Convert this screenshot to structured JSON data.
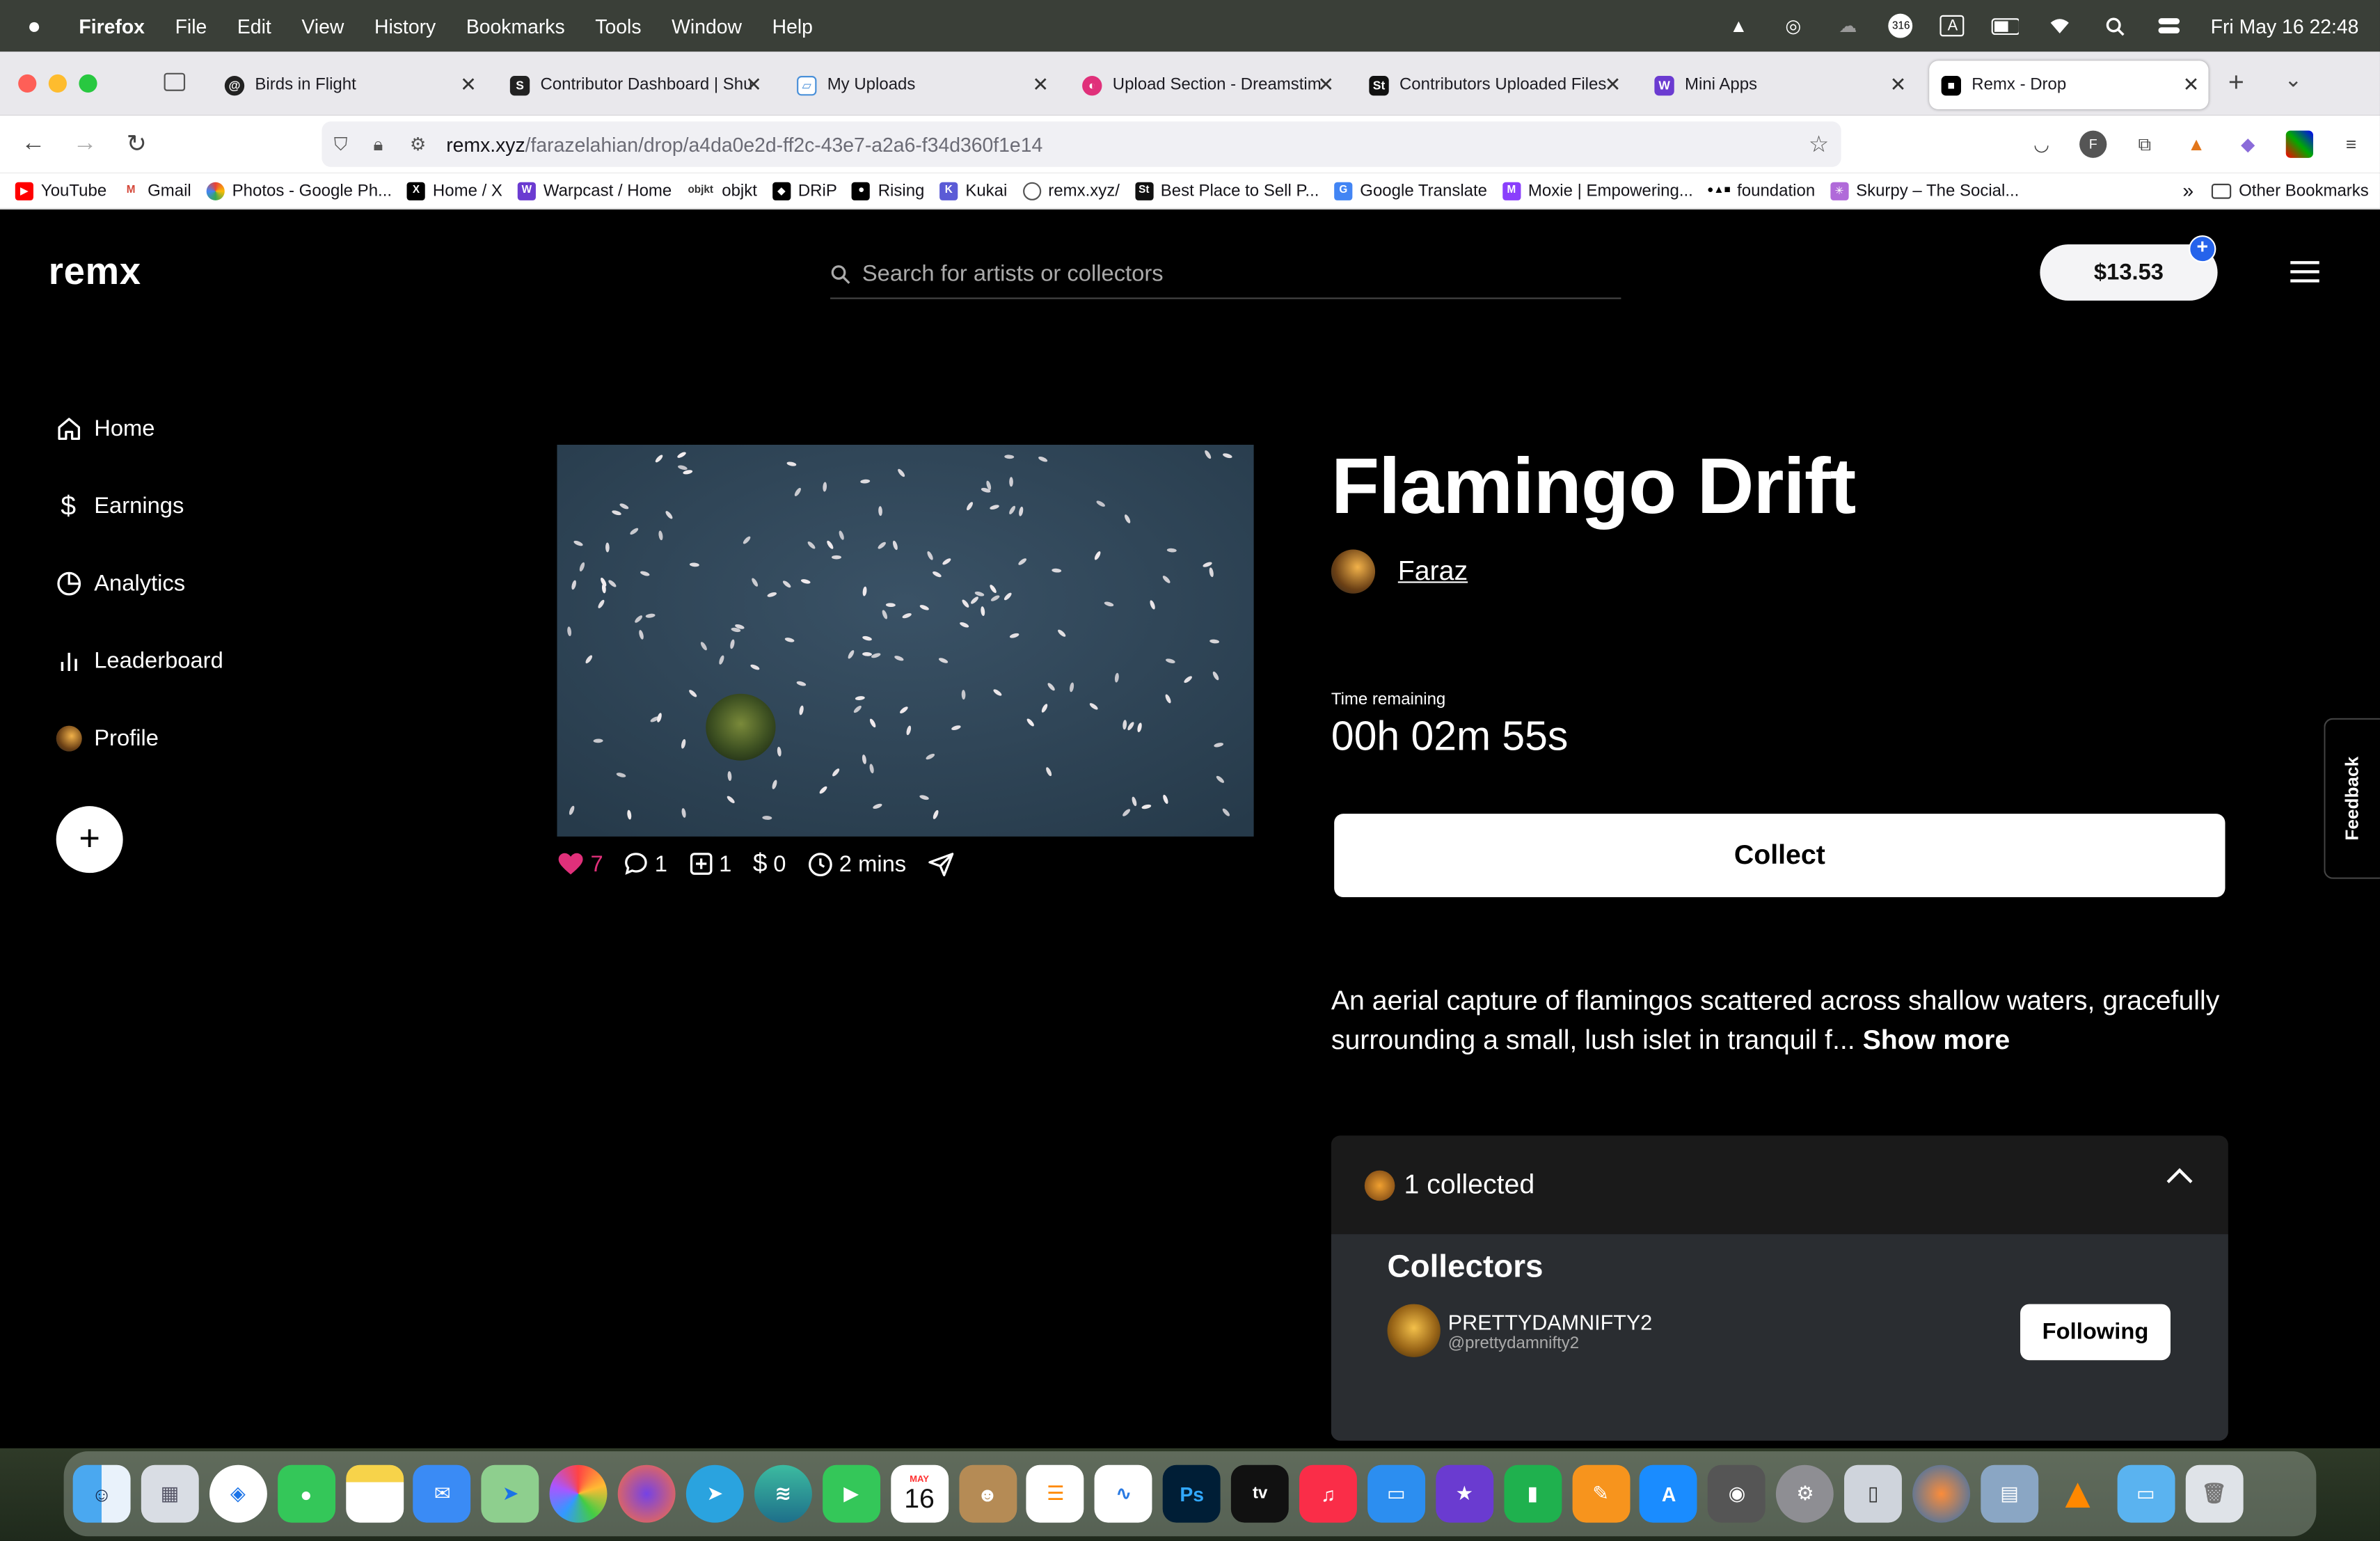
{
  "menubar": {
    "app": "Firefox",
    "items": [
      "File",
      "Edit",
      "View",
      "History",
      "Bookmarks",
      "Tools",
      "Window",
      "Help"
    ],
    "datetime": "Fri May 16  22:48",
    "badge_count": "316",
    "input_source": "A"
  },
  "tabs": [
    {
      "label": "Birds in Flight",
      "icon": "threads-icon",
      "color": "#222"
    },
    {
      "label": "Contributor Dashboard | Shu",
      "icon": "shutterstock-icon",
      "color": "#222"
    },
    {
      "label": "My Uploads",
      "icon": "uploads-icon",
      "color": "#4a90d9"
    },
    {
      "label": "Upload Section - Dreamstim",
      "icon": "dreamstime-icon",
      "color": "#e0307a"
    },
    {
      "label": "Contributors Uploaded Files",
      "icon": "stocksy-icon",
      "color": "#111"
    },
    {
      "label": "Mini Apps",
      "icon": "warpcast-icon",
      "color": "#6b3bd1"
    },
    {
      "label": "Remx - Drop",
      "icon": "remx-icon",
      "color": "#000"
    }
  ],
  "url": {
    "host": "remx.xyz",
    "path": "/farazelahian/drop/a4da0e2d-ff2c-43e7-a2a6-f34d360f1e14"
  },
  "bookmarks": [
    {
      "label": "YouTube",
      "color": "#ff0000"
    },
    {
      "label": "Gmail",
      "color": "#d44638"
    },
    {
      "label": "Photos - Google Ph...",
      "color": "#fbbc04"
    },
    {
      "label": "Home / X",
      "color": "#000"
    },
    {
      "label": "Warpcast / Home",
      "color": "#6b3bd1"
    },
    {
      "label": "objkt",
      "color": "#333"
    },
    {
      "label": "DRiP",
      "color": "#000"
    },
    {
      "label": "Rising",
      "color": "#000"
    },
    {
      "label": "Kukai",
      "color": "#5b5bd6"
    },
    {
      "label": "remx.xyz/",
      "color": "#555"
    },
    {
      "label": "Best Place to Sell P...",
      "color": "#111"
    },
    {
      "label": "Google Translate",
      "color": "#4285f4"
    },
    {
      "label": "Moxie | Empowering...",
      "color": "#8a3ffc"
    },
    {
      "label": "foundation",
      "color": "#000"
    },
    {
      "label": "Skurpy – The Social...",
      "color": "#b06ad9"
    }
  ],
  "other_bookmarks": "Other Bookmarks",
  "site": {
    "logo": "remx",
    "search_placeholder": "Search for artists or collectors",
    "balance": "$13.53",
    "nav": [
      {
        "label": "Home",
        "icon": "home-icon"
      },
      {
        "label": "Earnings",
        "icon": "dollar-icon"
      },
      {
        "label": "Analytics",
        "icon": "pie-chart-icon"
      },
      {
        "label": "Leaderboard",
        "icon": "bar-chart-icon"
      },
      {
        "label": "Profile",
        "icon": "avatar-icon"
      }
    ]
  },
  "drop": {
    "title": "Flamingo Drift",
    "artist": "Faraz",
    "stats": {
      "likes": "7",
      "comments": "1",
      "collects": "1",
      "earnings": "0",
      "age": "2 mins"
    },
    "time_remaining_label": "Time remaining",
    "time_remaining": "00h 02m 55s",
    "collect_label": "Collect",
    "description": "An aerial capture of flamingos scattered across shallow waters, gracefully surrounding a small, lush islet in tranquil f...",
    "show_more": "Show more",
    "collected_summary": "1 collected",
    "collectors_title": "Collectors",
    "collectors": [
      {
        "name": "PRETTYDAMNIFTY2",
        "handle": "@prettydamnifty2",
        "action": "Following"
      }
    ]
  },
  "feedback_label": "Feedback",
  "colors": {
    "accent": "#2563eb",
    "like": "#e0307a",
    "background": "#000000"
  },
  "dock": [
    "finder",
    "launchpad",
    "safari",
    "messages",
    "notes",
    "mail",
    "maps",
    "photos",
    "firefox",
    "telegram",
    "app",
    "facetime",
    "calendar",
    "contacts",
    "reminders",
    "freeform",
    "photoshop",
    "tv",
    "music",
    "keynote",
    "imovie",
    "numbers",
    "pages",
    "app-store",
    "screenshot",
    "settings",
    "iphone",
    "globe",
    "preview",
    "vlc",
    "folder",
    "trash"
  ],
  "dock_calendar": {
    "month": "MAY",
    "day": "16"
  }
}
